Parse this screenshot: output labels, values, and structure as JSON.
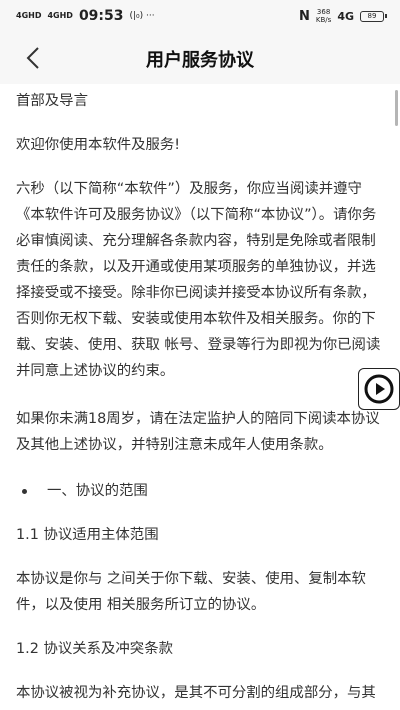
{
  "status_bar": {
    "sim1": "4GHD",
    "sim2": "4GHD",
    "time": "09:53",
    "extra": "(|₀) ···",
    "net_speed_value": "368",
    "net_speed_unit": "KB/s",
    "signal_right": "4G",
    "battery_level": "89"
  },
  "nav": {
    "back_icon": "chevron-left-icon",
    "title": "用户服务协议"
  },
  "content": {
    "heading": "首部及导言",
    "welcome": "欢迎你使用本软件及服务!",
    "intro": "六秒（以下简称“本软件”）及服务，你应当阅读并遵守《本软件许可及服务协议》（以下简称“本协议”）。请你务必审慎阅读、充分理解各条款内容，特别是免除或者限制责任的条款，以及开通或使用某项服务的单独协议，并选择接受或不接受。除非你已阅读并接受本协议所有条款，否则你无权下载、安装或使用本软件及相关服务。你的下载、安装、使用、获取 帐号、登录等行为即视为你已阅读并同意上述协议的约束。",
    "minor": "如果你未满18周岁，请在法定监护人的陪同下阅读本协议及其他上述协议，并特别注意未成年人使用条款。",
    "section1_title": "一、协议的范围",
    "s1_1_title": "1.1 协议适用主体范围",
    "s1_1_body": "本协议是你与 之间关于你下载、安装、使用、复制本软件，以及使用 相关服务所订立的协议。",
    "s1_2_title": "1.2 协议关系及冲突条款",
    "s1_2_body": "本协议被视为补充协议，是其不可分割的组成部分，与其构成统一整体。本协议与上述内容存在冲突的"
  },
  "floating": {
    "icon": "play-circle-icon"
  }
}
